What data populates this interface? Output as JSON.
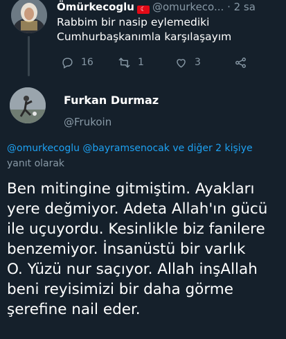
{
  "parent_tweet": {
    "author_name": "Ömürkecoglu",
    "flag": "🇹🇷",
    "handle": "@omurkeco...",
    "separator": "·",
    "time": "2 sa",
    "text_line1": "Rabbim bir nasip eylemediki",
    "text_line2": "Cumhurbaşkanımla karşılaşayım",
    "reply_count": "16",
    "retweet_count": "1",
    "like_count": "3"
  },
  "reply_tweet": {
    "author_name": "Furkan Durmaz",
    "handle": "@Frukoin",
    "reply_mentions": "@omurkecoglu @bayramsenocak",
    "reply_others": "ve diğer 2 kişiye",
    "reply_label": "yanıt olarak",
    "body": [
      "Ben mitingine gitmiştim. Ayakları",
      "yere değmiyor. Adeta Allah'ın gücü",
      "ile uçuyordu. Kesinlikle biz fanilere",
      "benzemiyor. İnsanüstü bir varlık",
      "O. Yüzü nur saçıyor. Allah inşAllah",
      "beni reyisimizi bir daha görme",
      "şerefine nail eder."
    ]
  },
  "colors": {
    "background": "#15202b",
    "text": "#ffffff",
    "secondary": "#8899a6",
    "link": "#1da1f2",
    "flag": "#e30a17"
  },
  "icons": [
    "reply-icon",
    "retweet-icon",
    "like-icon",
    "share-icon",
    "turkish-flag-icon"
  ]
}
